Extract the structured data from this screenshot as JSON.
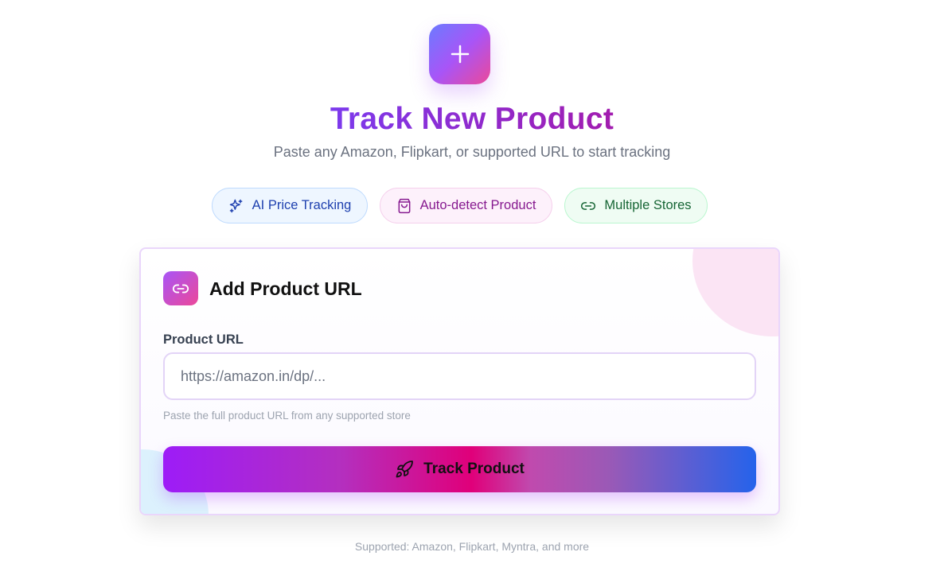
{
  "hero": {
    "icon": "plus-icon",
    "title": "Track New Product",
    "subtitle": "Paste any Amazon, Flipkart, or supported URL to start tracking"
  },
  "features": [
    {
      "label": "AI Price Tracking",
      "icon": "sparkles-icon",
      "color": "#1e40af"
    },
    {
      "label": "Auto-detect Product",
      "icon": "shopping-bag-icon",
      "color": "#86198f"
    },
    {
      "label": "Multiple Stores",
      "icon": "link-icon",
      "color": "#166534"
    }
  ],
  "card": {
    "icon": "link-icon",
    "title": "Add Product URL",
    "field_label": "Product URL",
    "url_placeholder": "https://amazon.in/dp/...",
    "url_value": "",
    "helper": "Paste the full product URL from any supported store",
    "button_label": "Track Product",
    "button_icon": "rocket-icon"
  },
  "footer": {
    "note": "Supported: Amazon, Flipkart, Myntra, and more"
  },
  "colors": {
    "accent_purple": "#9333ea",
    "accent_pink": "#ec4899",
    "accent_blue": "#2563eb"
  }
}
